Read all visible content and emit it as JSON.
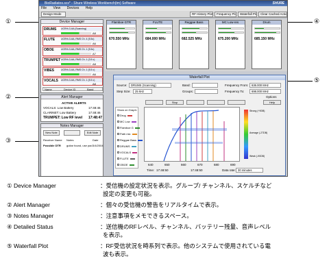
{
  "callouts": [
    "①",
    "②",
    "③",
    "④",
    "⑤"
  ],
  "app": {
    "title": "BioRadiatos.scs* - Shure Wireless Workbench(tm) Software",
    "logo": "SHURE",
    "menu": [
      "File",
      "View",
      "Devices",
      "Help"
    ],
    "mode": "Design Mode",
    "toolbar_buttons": [
      "RF History Plot",
      "Frequency Plot",
      "Waterfall Plot",
      "Clear Cached Actions"
    ]
  },
  "device_manager": {
    "title": "Device Manager",
    "devices": [
      {
        "name": "DRUMS",
        "sub": "UCRH-G-6A (Scanning)",
        "ch": "A8"
      },
      {
        "name": "FLUTE",
        "sub": "UCRH-G-6A, RMS Ch. 4 (5.5c)",
        "ch": "A6"
      },
      {
        "name": "OBOE",
        "sub": "UCRH-G-6A, RMS Ch. 1 (5.5c)",
        "ch": "A7"
      },
      {
        "name": "TRUMPET",
        "sub": "UCRH-G-6A, RMS Ch. 1 (3.5 c)",
        "ch": "A8"
      },
      {
        "name": "VIBES",
        "sub": "UCRH-G-6A, RMS Ch. 1 (5.5 c)",
        "ch": "A6"
      },
      {
        "name": "VOCALS",
        "sub": "UCRH-G-6A, RMS Ch. 1 (5.5 c)",
        "ch": "A8"
      }
    ],
    "columns": [
      "Name",
      "Device ID",
      "Band"
    ]
  },
  "alert_manager": {
    "title": "Alert Manager",
    "subtitle": "ACTIVE ALERTS",
    "alerts": [
      {
        "text": "VOCALS: Low Battery",
        "time": "17:48:46"
      },
      {
        "text": "CLARINET: Low Battery",
        "time": "17:48:46"
      },
      {
        "text": "TRUMPET: Low RF level",
        "time": "17:48:47"
      }
    ]
  },
  "notes_manager": {
    "title": "Notes Manager",
    "buttons": [
      "New Note",
      "",
      "Edit Note"
    ],
    "columns": [
      "Receiver Name",
      "Notes",
      "Date"
    ],
    "rows": [
      {
        "receiver": "Possible DTR",
        "notes": "guitar found, use pad",
        "date": "3/4/2004"
      }
    ]
  },
  "detailed_status": {
    "panels": [
      {
        "name": "Flamboe GTR",
        "freq": "670.550 MHz"
      },
      {
        "name": "FLUTE",
        "freq": "684.000 MHz"
      },
      {
        "name": "Reggae Bass",
        "freq": "682.525 MHz"
      },
      {
        "name": "MC Low-res",
        "freq": "675.200 MHz"
      },
      {
        "name": "Drum",
        "freq": "685.150 MHz"
      }
    ]
  },
  "waterfall": {
    "title": "Waterfall Plot",
    "source_label": "Source:",
    "source_value": "DRUMS (Scanning)",
    "band_label": "Band:",
    "step_label": "Step Size:",
    "step_value": "25 kHz",
    "groups_label": "Groups:",
    "freq_from_label": "Frequency From:",
    "freq_from_value": "636.000 MHz",
    "freq_to_label": "Frequency To:",
    "freq_to_value": "698.000 MHz",
    "options": "Options",
    "show_label": "Show on Graph:",
    "legend": [
      {
        "name": "Drug",
        "color": "#d04040"
      },
      {
        "name": "MC Low",
        "color": "#9a40c0"
      },
      {
        "name": "Flamboe G",
        "color": "#2a8a2a"
      },
      {
        "name": "Path mic",
        "color": "#e08a20"
      },
      {
        "name": "Reggae Bass",
        "color": "#2050d0"
      },
      {
        "name": "DRUMS",
        "color": "#40a0c0"
      },
      {
        "name": "VOCALS",
        "color": "#c03080"
      },
      {
        "name": "FLUTE",
        "color": "#606060"
      },
      {
        "name": "OBOE",
        "color": "#309030"
      }
    ],
    "tools": [
      "",
      "Stop",
      "",
      "",
      "",
      "Help"
    ],
    "x_ticks": [
      "640",
      "650",
      "660",
      "670",
      "680",
      "690"
    ],
    "scale": [
      "Strong (+9DB)",
      "Average (-27DB)",
      "Weak (-90DB)"
    ],
    "footer_left": "17:48:50",
    "footer_mid": "17:48:50",
    "footer_interval": "30 minutes",
    "time_label": "Time:",
    "interval_label": "Data rate:"
  },
  "labels": [
    {
      "num": "①",
      "key": "Device Manager",
      "text": "：受信機の設定状況を表示。グループ/ チャンネル、スケルチなど"
    },
    {
      "num": "",
      "key": "",
      "text": "設定の変更も可能。"
    },
    {
      "num": "②",
      "key": "Alert Manager",
      "text": "：個々の受信機の警告をリアルタイムで表示。"
    },
    {
      "num": "③",
      "key": "Notes Manager",
      "text": "：注意事項をメモできるスペース。"
    },
    {
      "num": "④",
      "key": "Detailed Status",
      "text": "：送信機のRFレベル、チャンネル、バッテリー残量、音声レベル"
    },
    {
      "num": "",
      "key": "",
      "text": "を表示。"
    },
    {
      "num": "⑤",
      "key": "Waterfall Plot",
      "text": "：RF受信状況を時系列で表示。他のシステムで使用されている電"
    },
    {
      "num": "",
      "key": "",
      "text": "波も表示。"
    }
  ]
}
